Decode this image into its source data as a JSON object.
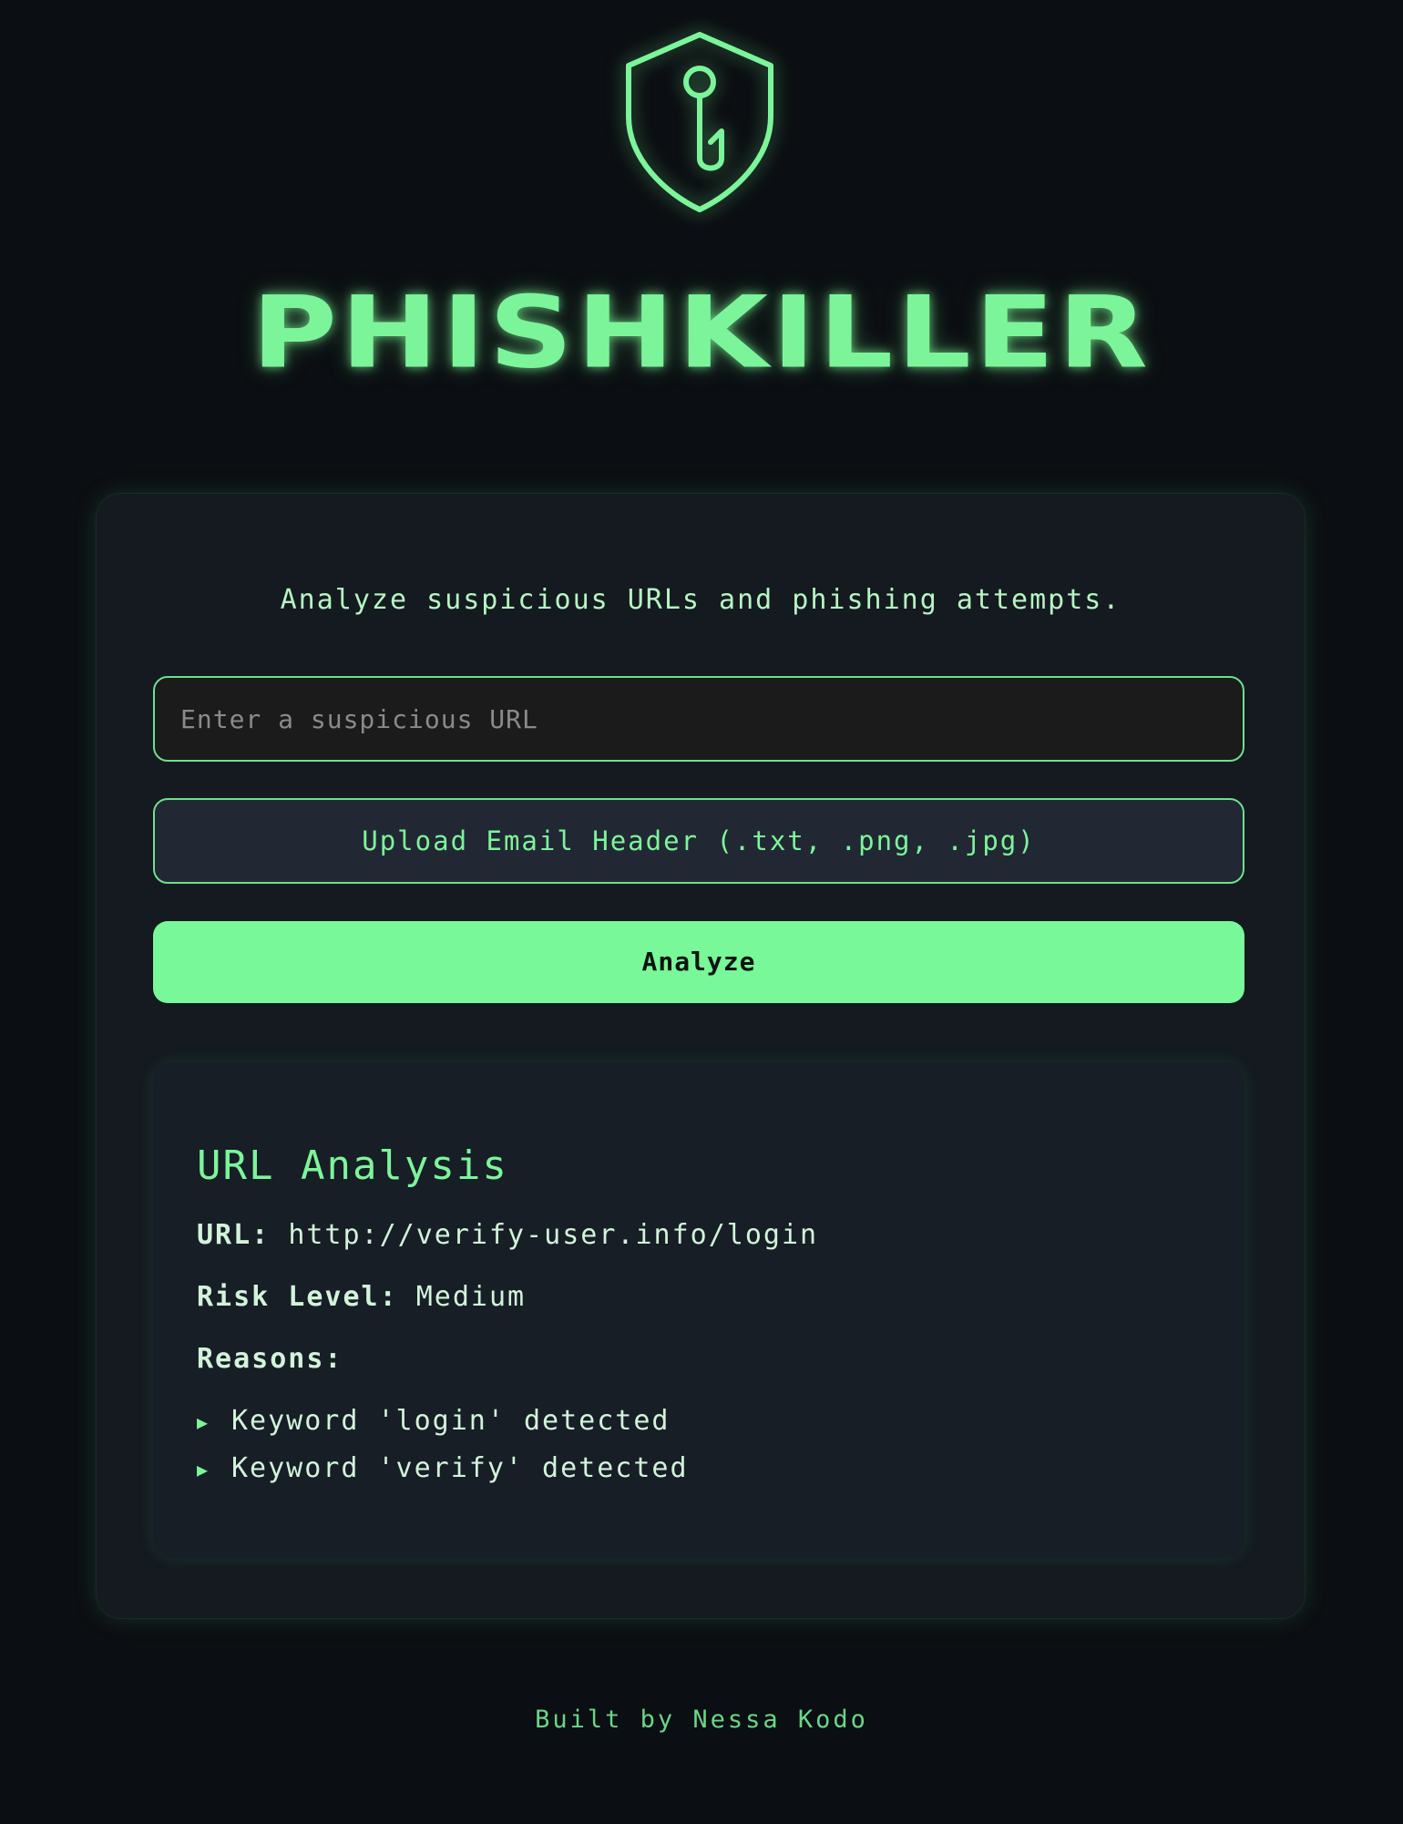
{
  "brand": {
    "logo_icon": "shield-fishhook-icon",
    "title": "PHISHKILLER"
  },
  "main": {
    "tagline": "Analyze suspicious URLs and phishing attempts.",
    "url_input": {
      "placeholder": "Enter a suspicious URL",
      "value": ""
    },
    "upload_label": "Upload Email Header (.txt, .png, .jpg)",
    "analyze_label": "Analyze"
  },
  "result": {
    "title": "URL Analysis",
    "url_label": "URL:",
    "url_value": "http://verify-user.info/login",
    "risk_label": "Risk Level:",
    "risk_value": "Medium",
    "reasons_label": "Reasons:",
    "reasons": [
      "Keyword 'login' detected",
      "Keyword 'verify' detected"
    ]
  },
  "footer": {
    "text": "Built by Nessa Kodo"
  },
  "colors": {
    "accent": "#78f898",
    "background": "#0b0e12",
    "card": "#141a20"
  }
}
